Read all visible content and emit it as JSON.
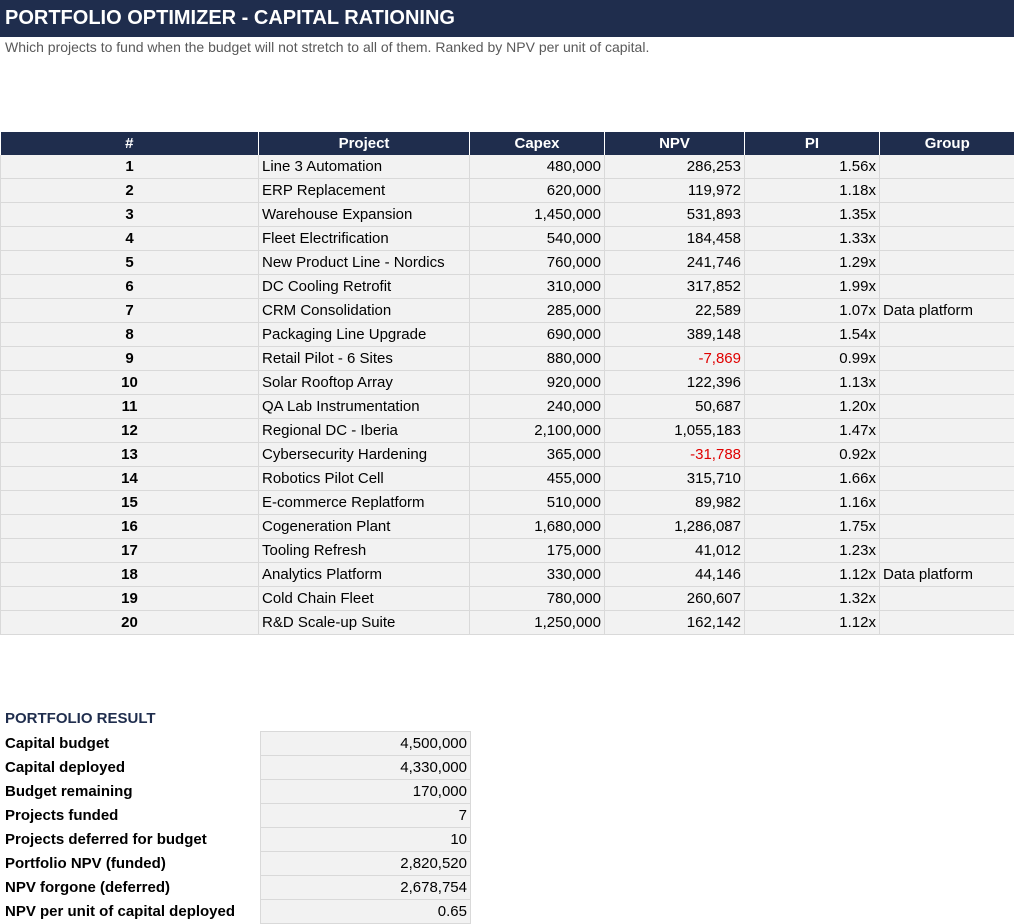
{
  "header": {
    "title": "PORTFOLIO OPTIMIZER - CAPITAL RATIONING",
    "subtitle": "Which projects to fund when the budget will not stretch to all of them. Ranked by NPV per unit of capital."
  },
  "table": {
    "columns": [
      "#",
      "Project",
      "Capex",
      "NPV",
      "PI",
      "Group"
    ],
    "rows": [
      {
        "num": "1",
        "project": "Line 3 Automation",
        "capex": "480,000",
        "npv": "286,253",
        "pi": "1.56x",
        "group": ""
      },
      {
        "num": "2",
        "project": "ERP Replacement",
        "capex": "620,000",
        "npv": "119,972",
        "pi": "1.18x",
        "group": ""
      },
      {
        "num": "3",
        "project": "Warehouse Expansion",
        "capex": "1,450,000",
        "npv": "531,893",
        "pi": "1.35x",
        "group": ""
      },
      {
        "num": "4",
        "project": "Fleet Electrification",
        "capex": "540,000",
        "npv": "184,458",
        "pi": "1.33x",
        "group": ""
      },
      {
        "num": "5",
        "project": "New Product Line - Nordics",
        "capex": "760,000",
        "npv": "241,746",
        "pi": "1.29x",
        "group": ""
      },
      {
        "num": "6",
        "project": "DC Cooling Retrofit",
        "capex": "310,000",
        "npv": "317,852",
        "pi": "1.99x",
        "group": ""
      },
      {
        "num": "7",
        "project": "CRM Consolidation",
        "capex": "285,000",
        "npv": "22,589",
        "pi": "1.07x",
        "group": "Data platform"
      },
      {
        "num": "8",
        "project": "Packaging Line Upgrade",
        "capex": "690,000",
        "npv": "389,148",
        "pi": "1.54x",
        "group": ""
      },
      {
        "num": "9",
        "project": "Retail Pilot - 6 Sites",
        "capex": "880,000",
        "npv": "-7,869",
        "pi": "0.99x",
        "group": ""
      },
      {
        "num": "10",
        "project": "Solar Rooftop Array",
        "capex": "920,000",
        "npv": "122,396",
        "pi": "1.13x",
        "group": ""
      },
      {
        "num": "11",
        "project": "QA Lab Instrumentation",
        "capex": "240,000",
        "npv": "50,687",
        "pi": "1.20x",
        "group": ""
      },
      {
        "num": "12",
        "project": "Regional DC - Iberia",
        "capex": "2,100,000",
        "npv": "1,055,183",
        "pi": "1.47x",
        "group": ""
      },
      {
        "num": "13",
        "project": "Cybersecurity Hardening",
        "capex": "365,000",
        "npv": "-31,788",
        "pi": "0.92x",
        "group": ""
      },
      {
        "num": "14",
        "project": "Robotics Pilot Cell",
        "capex": "455,000",
        "npv": "315,710",
        "pi": "1.66x",
        "group": ""
      },
      {
        "num": "15",
        "project": "E-commerce Replatform",
        "capex": "510,000",
        "npv": "89,982",
        "pi": "1.16x",
        "group": ""
      },
      {
        "num": "16",
        "project": "Cogeneration Plant",
        "capex": "1,680,000",
        "npv": "1,286,087",
        "pi": "1.75x",
        "group": ""
      },
      {
        "num": "17",
        "project": "Tooling Refresh",
        "capex": "175,000",
        "npv": "41,012",
        "pi": "1.23x",
        "group": ""
      },
      {
        "num": "18",
        "project": "Analytics Platform",
        "capex": "330,000",
        "npv": "44,146",
        "pi": "1.12x",
        "group": "Data platform"
      },
      {
        "num": "19",
        "project": "Cold Chain Fleet",
        "capex": "780,000",
        "npv": "260,607",
        "pi": "1.32x",
        "group": ""
      },
      {
        "num": "20",
        "project": "R&D Scale-up Suite",
        "capex": "1,250,000",
        "npv": "162,142",
        "pi": "1.12x",
        "group": ""
      }
    ]
  },
  "results": {
    "heading": "PORTFOLIO RESULT",
    "items": [
      {
        "label": "Capital budget",
        "value": "4,500,000"
      },
      {
        "label": "Capital deployed",
        "value": "4,330,000"
      },
      {
        "label": "Budget remaining",
        "value": "170,000"
      },
      {
        "label": "Projects funded",
        "value": "7"
      },
      {
        "label": "Projects deferred for budget",
        "value": "10"
      },
      {
        "label": "Portfolio NPV (funded)",
        "value": "2,820,520"
      },
      {
        "label": "NPV forgone (deferred)",
        "value": "2,678,754"
      },
      {
        "label": "NPV per unit of capital deployed",
        "value": "0.65"
      }
    ]
  },
  "colors": {
    "header_bg": "#1f2d4d",
    "cell_bg": "#f2f2f2",
    "negative": "#e00000",
    "subtitle": "#595959"
  }
}
